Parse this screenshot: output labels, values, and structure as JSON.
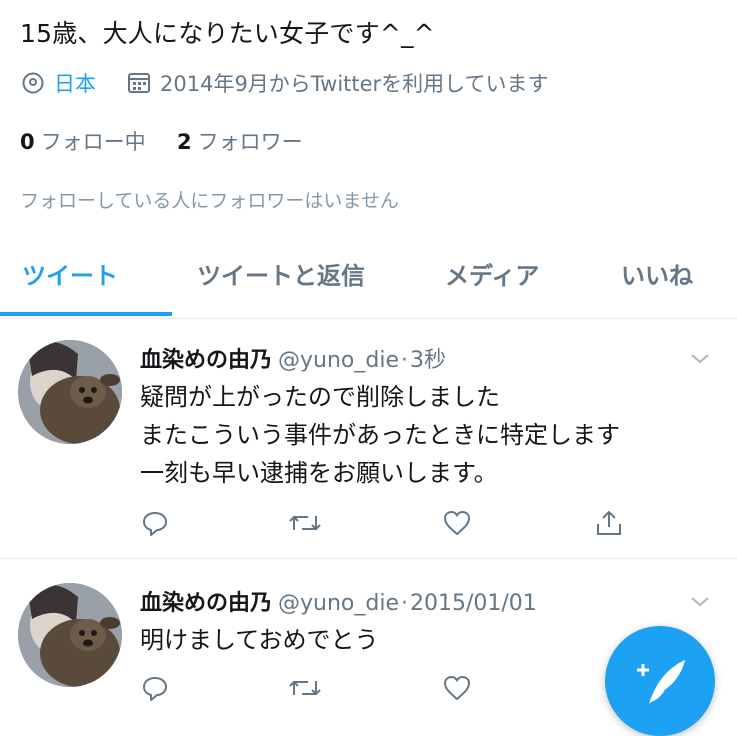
{
  "profile": {
    "bio": "15歳、大人になりたい女子です^_^",
    "location": "日本",
    "joined": "2014年9月からTwitterを利用しています",
    "following_count": "0",
    "following_label": "フォロー中",
    "followers_count": "2",
    "followers_label": "フォロワー",
    "followers_you_know": "フォローしている人にフォロワーはいません"
  },
  "tabs": [
    {
      "label": "ツイート",
      "active": true
    },
    {
      "label": "ツイートと返信",
      "active": false
    },
    {
      "label": "メディア",
      "active": false
    },
    {
      "label": "いいね",
      "active": false
    }
  ],
  "tweets": [
    {
      "name": "血染めの由乃",
      "handle": "@yuno_die",
      "separator": "·",
      "time": "3秒",
      "lines": [
        "疑問が上がったので削除しました",
        "またこういう事件があったときに特定します",
        "一刻も早い逮捕をお願いします。"
      ]
    },
    {
      "name": "血染めの由乃",
      "handle": "@yuno_die",
      "separator": "·",
      "time": "2015/01/01",
      "lines": [
        "明けましておめでとう"
      ]
    }
  ],
  "icons": {
    "location": "location-pin-icon",
    "calendar": "calendar-icon",
    "reply": "reply-icon",
    "retweet": "retweet-icon",
    "like": "heart-icon",
    "share": "share-icon",
    "more": "chevron-down-icon",
    "compose": "compose-tweet-icon"
  },
  "colors": {
    "accent": "#1da1f2",
    "secondary_text": "#657786",
    "divider": "#e6ecf0"
  }
}
